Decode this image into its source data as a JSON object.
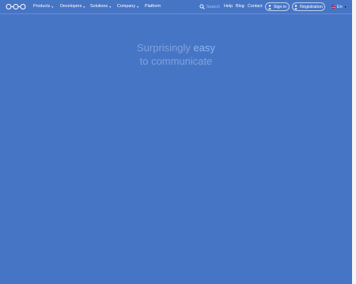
{
  "nav": {
    "logo_name": "infinity-logo",
    "items": [
      {
        "label": "Products",
        "has_dropdown": true
      },
      {
        "label": "Developers",
        "has_dropdown": true
      },
      {
        "label": "Solutions",
        "has_dropdown": true
      },
      {
        "label": "Company",
        "has_dropdown": true
      },
      {
        "label": "Platform",
        "has_dropdown": false
      }
    ],
    "search_label": "Search",
    "links": [
      "Help",
      "Blog",
      "Contact"
    ],
    "sign_in_label": "Sign in",
    "registration_label": "Registration",
    "language_label": "En"
  },
  "hero": {
    "line1_prefix": "Surprisingly ",
    "line1_highlight": "easy",
    "line2": "to communicate"
  },
  "colors": {
    "background": "#4775c6",
    "hero_text": "#7fa2dc",
    "hero_highlight": "#8fb6f0",
    "nav_text": "#ffffff"
  },
  "icons": {
    "search": "search-icon",
    "sign_in": "user-icon",
    "registration": "user-icon",
    "language": "flag-icon",
    "dropdown": "chevron-down-icon"
  }
}
